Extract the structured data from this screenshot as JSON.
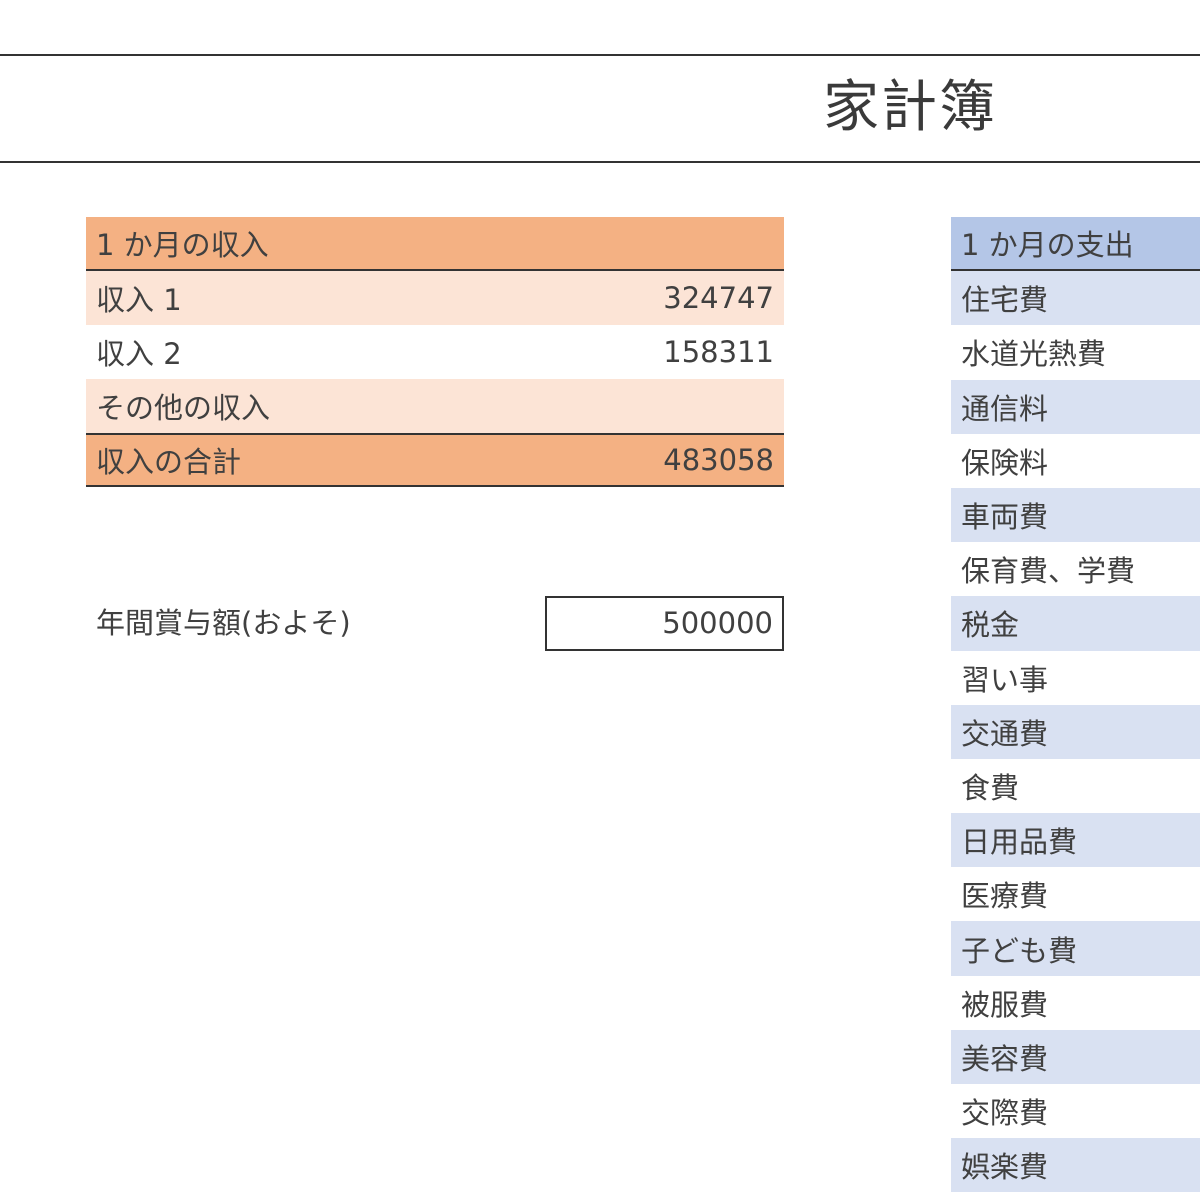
{
  "title": "家計簿",
  "income": {
    "header": "1 か月の収入",
    "rows": [
      {
        "label": "収入 1",
        "value": "324747"
      },
      {
        "label": "収入 2",
        "value": "158311"
      },
      {
        "label": "その他の収入",
        "value": ""
      }
    ],
    "total": {
      "label": "収入の合計",
      "value": "483058"
    }
  },
  "bonus": {
    "label": "年間賞与額(およそ)",
    "value": "500000"
  },
  "expenses": {
    "header": "1 か月の支出",
    "items": [
      "住宅費",
      "水道光熱費",
      "通信料",
      "保険料",
      "車両費",
      "保育費、学費",
      "税金",
      "習い事",
      "交通費",
      "食費",
      "日用品費",
      "医療費",
      "子ども費",
      "被服費",
      "美容費",
      "交際費",
      "娯楽費"
    ]
  },
  "colors": {
    "income_header": "#f4b183",
    "income_band": "#fce4d6",
    "expense_header": "#b4c6e7",
    "expense_band": "#d9e1f2"
  }
}
